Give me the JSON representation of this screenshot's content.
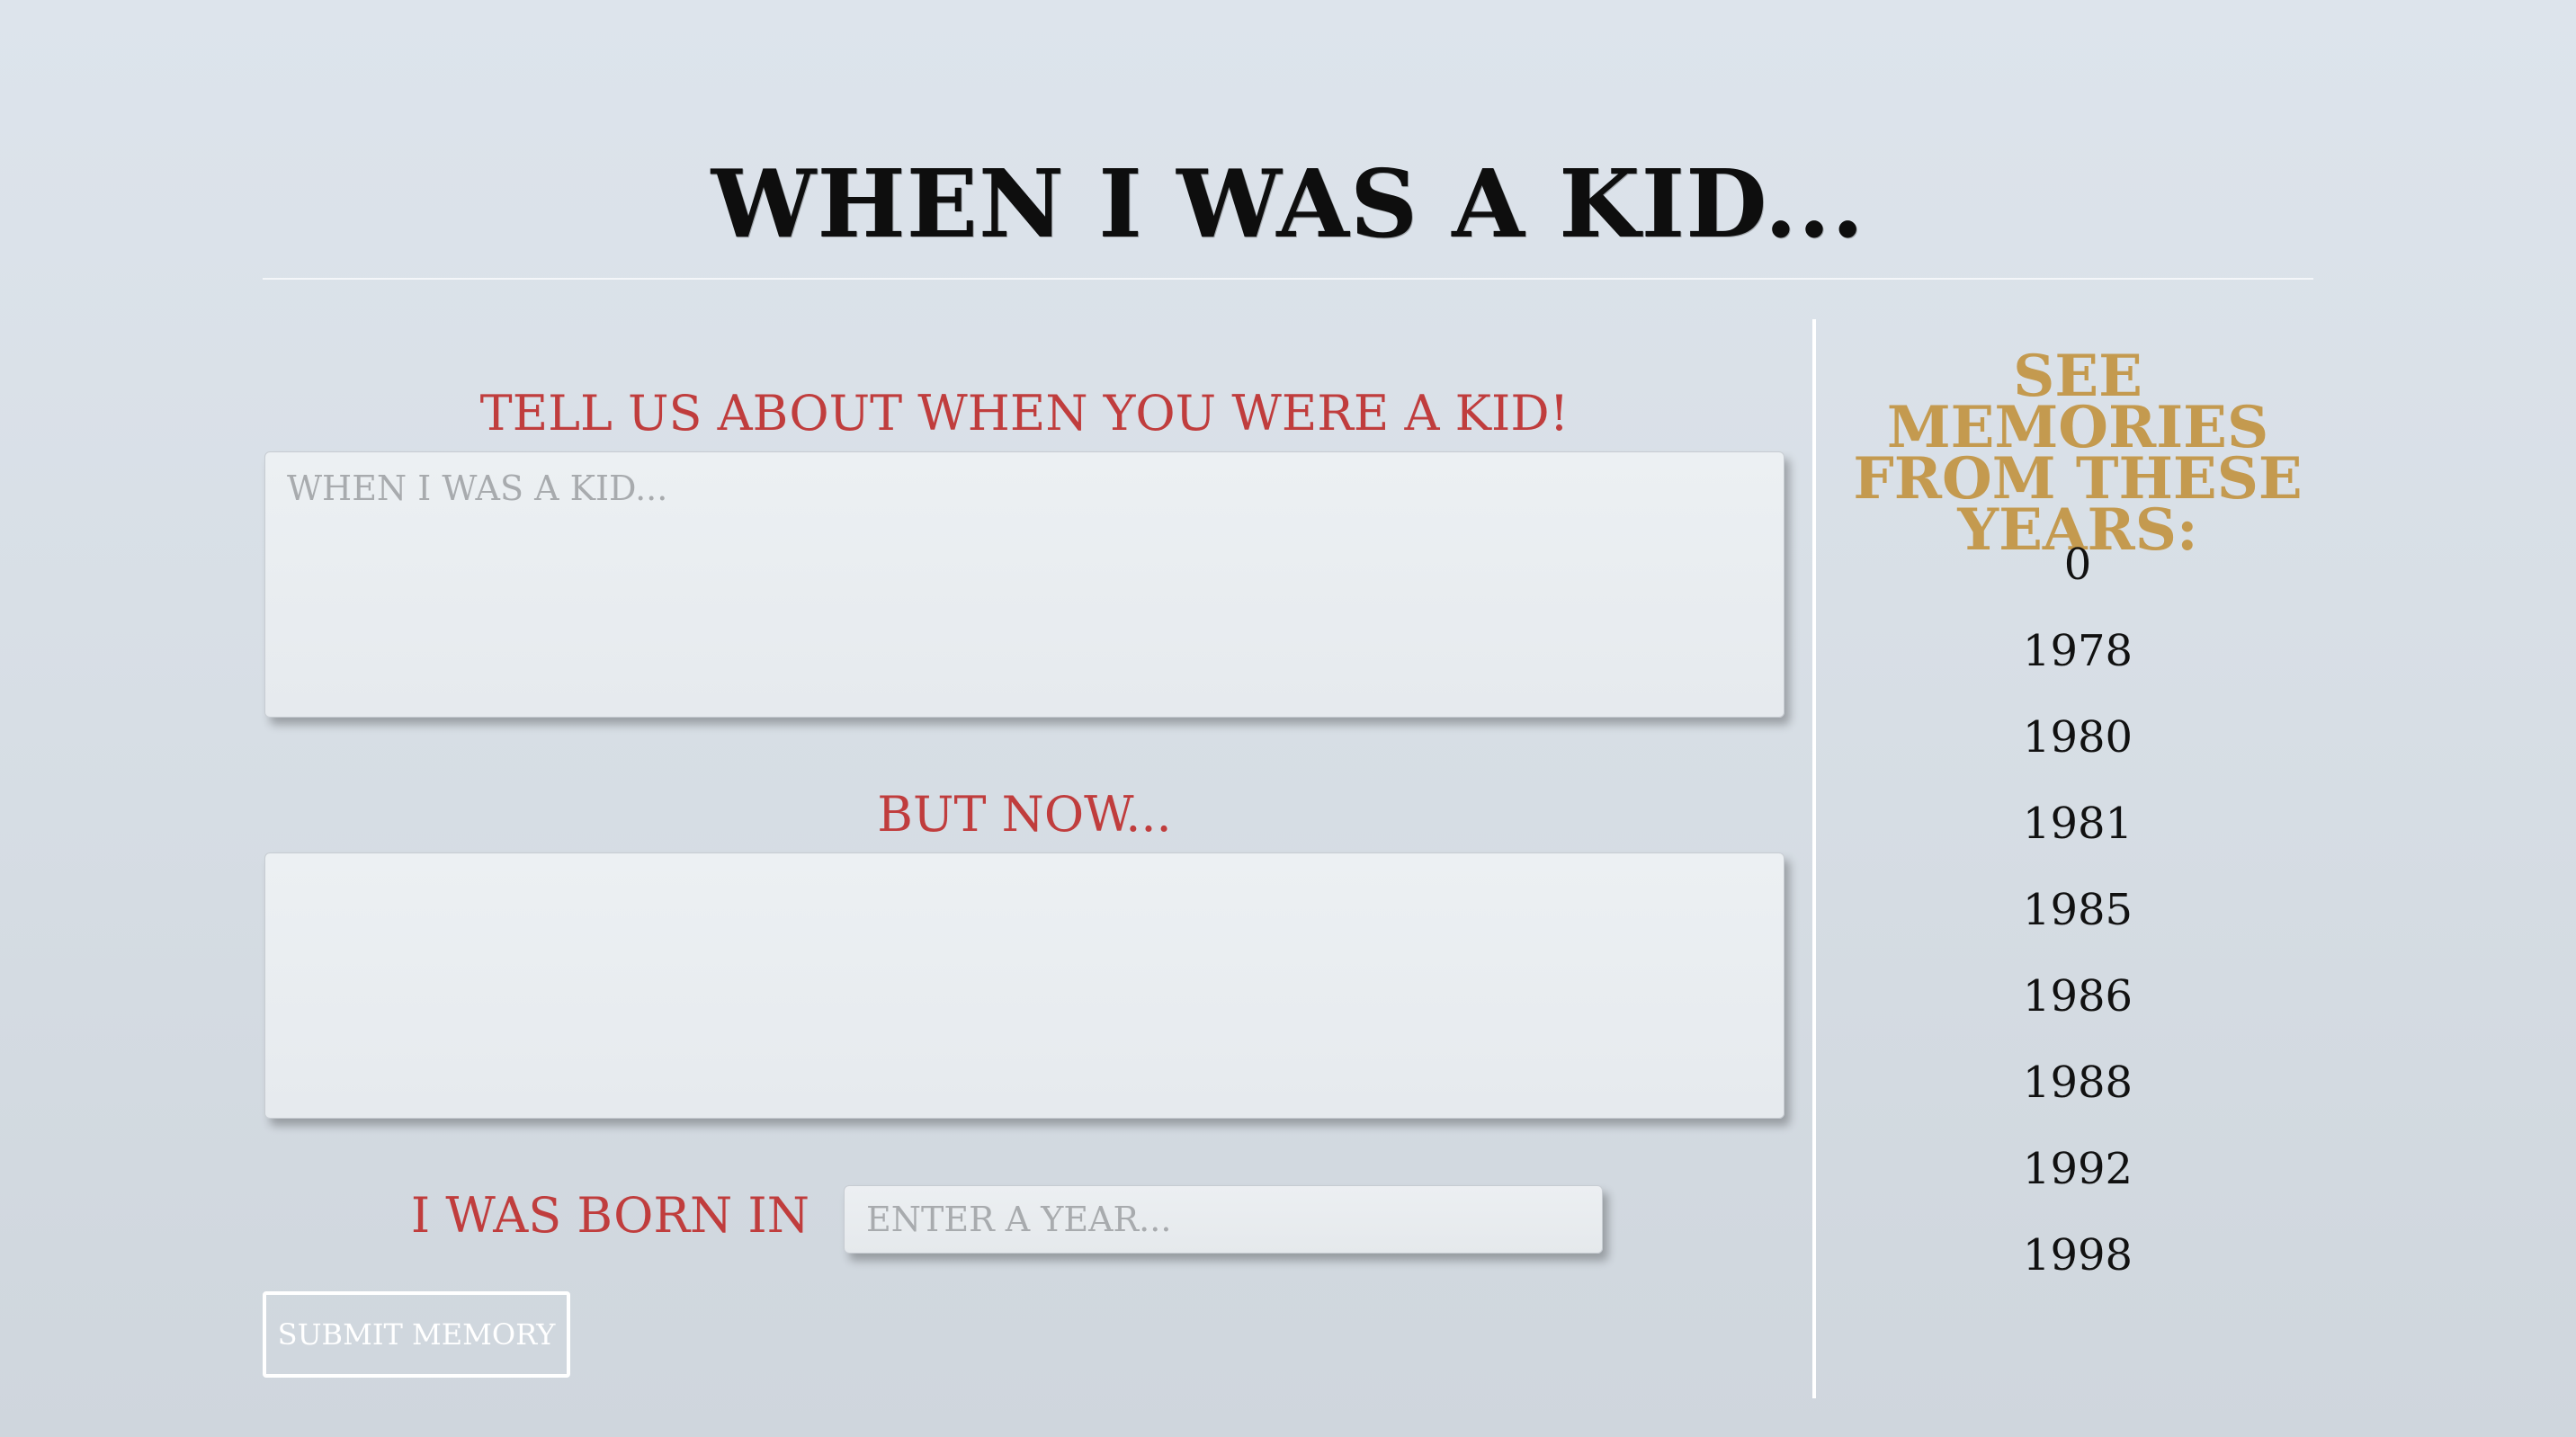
{
  "page": {
    "title": "WHEN I WAS A KID..."
  },
  "form": {
    "memory_label": "TELL US ABOUT WHEN YOU WERE A KID!",
    "memory_placeholder": "WHEN I WAS A KID...",
    "memory_value": "",
    "now_label": "BUT NOW...",
    "now_placeholder": "",
    "now_value": "",
    "born_label": "I WAS BORN IN",
    "year_placeholder": "ENTER A YEAR...",
    "year_value": "",
    "submit_label": "SUBMIT MEMORY"
  },
  "sidebar": {
    "title": "SEE MEMORIES FROM THESE YEARS:",
    "years": [
      "0",
      "1978",
      "1980",
      "1981",
      "1985",
      "1986",
      "1988",
      "1992",
      "1998"
    ]
  },
  "colors": {
    "accent_red": "#c03d3d",
    "accent_gold": "#c49a4f",
    "title_black": "#0e0e0e"
  }
}
